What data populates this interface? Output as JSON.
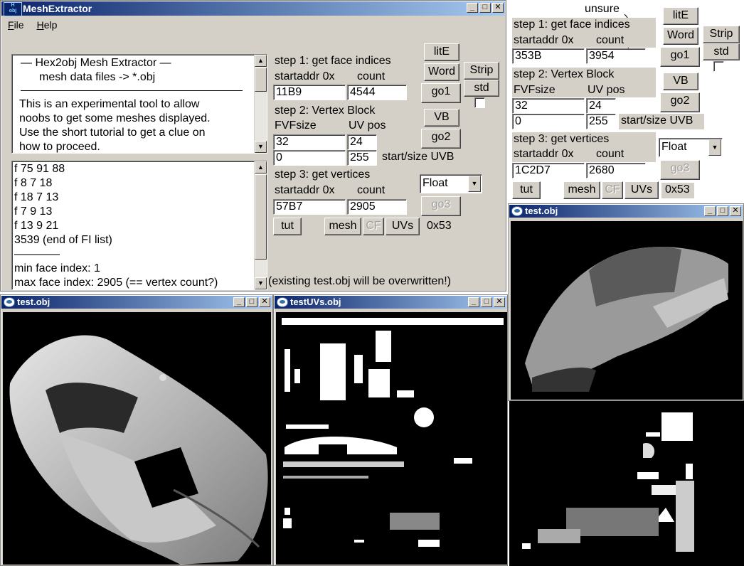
{
  "main": {
    "title": "MeshExtractor",
    "menu": [
      "File",
      "Help"
    ],
    "info_lines": [
      "—  Hex2obj Mesh Extractor  —",
      "mesh data files -> *.obj"
    ],
    "info_text": [
      "This is an experimental tool to allow",
      "noobs to get some meshes displayed.",
      "Use the short tutorial to get a clue on",
      "how to proceed."
    ],
    "log_lines": [
      "f  75 91 88",
      "f  8 7 18",
      "f  18 7 13",
      "f  7 9 13",
      "f  13 9 21",
      "3539 (end of FI list)",
      "————",
      "min face index: 1",
      "max face index: 2905 (== vertex count?)"
    ],
    "step1_label": "step 1: get face indices",
    "startaddr_label": "startaddr 0x",
    "count_label": "count",
    "step1_addr": "11B9",
    "step1_count": "4544",
    "step2_label": "step 2: Vertex Block",
    "fvf_label": "FVFsize",
    "uvpos_label": "UV pos",
    "fvf_value": "32",
    "uvpos_value": "24",
    "uvstart_value": "0",
    "uvsize_value": "255",
    "uvb_label": "start/size UVB",
    "step3_label": "step 3: get vertices",
    "step3_addr": "57B7",
    "step3_count": "2905",
    "format": "Float",
    "buttons": {
      "lite": "litE",
      "word": "Word",
      "strip": "Strip",
      "std": "std",
      "go1": "go1",
      "vb": "VB",
      "go2": "go2",
      "go3": "go3",
      "tut": "tut",
      "mesh": "mesh",
      "cf": "CF",
      "uvs": "UVs"
    },
    "hex_value": "0x53",
    "warning": "(existing test.obj will be overwritten!)"
  },
  "right_panel": {
    "annotation": "unsure",
    "step1_label": "step 1: get face indices",
    "startaddr_label": "startaddr 0x",
    "count_label": "count",
    "step1_addr": "353B",
    "step1_count": "3954",
    "step2_label": "step 2: Vertex Block",
    "fvf_label": "FVFsize",
    "uvpos_label": "UV pos",
    "fvf_value": "32",
    "uvpos_value": "24",
    "uvstart_value": "0",
    "uvsize_value": "255",
    "uvb_label": "start/size UVB",
    "step3_label": "step 3: get vertices",
    "step3_addr": "1C2D7",
    "step3_count": "2680",
    "format": "Float",
    "buttons": {
      "lite": "litE",
      "word": "Word",
      "strip": "Strip",
      "std": "std",
      "go1": "go1",
      "vb": "VB",
      "go2": "go2",
      "go3": "go3",
      "tut": "tut",
      "mesh": "mesh",
      "cf": "CF",
      "uvs": "UVs"
    },
    "hex_value": "0x53"
  },
  "viewers": {
    "test_left": "test.obj",
    "test_uvs": "testUVs.obj",
    "test_right": "test.obj"
  },
  "colors": {
    "titlebar": "#0a246a",
    "face": "#d4d0c8",
    "viewport": "#000000"
  }
}
